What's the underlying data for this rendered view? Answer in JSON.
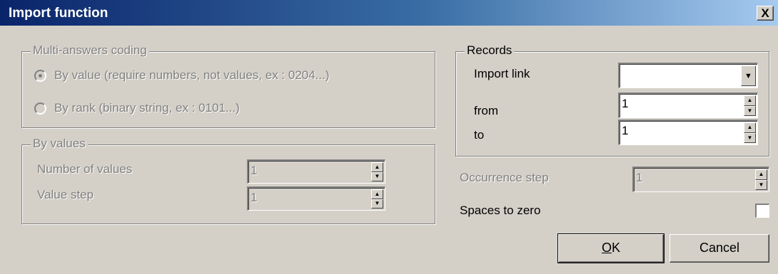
{
  "window": {
    "title": "Import function",
    "close_label": "X"
  },
  "multi_answers": {
    "legend": "Multi-answers coding",
    "options": [
      {
        "label": "By value (require numbers, not values, ex : 0204...)",
        "checked": true
      },
      {
        "label": "By rank (binary string, ex : 0101...)",
        "checked": false
      }
    ]
  },
  "by_values": {
    "legend": "By values",
    "number_of_values_label": "Number of values",
    "number_of_values": "1",
    "value_step_label": "Value step",
    "value_step": "1"
  },
  "records": {
    "legend": "Records",
    "import_link_label": "Import link",
    "import_link_value": "",
    "from_label": "from",
    "from_value": "1",
    "to_label": "to",
    "to_value": "1"
  },
  "occurrence_step_label": "Occurrence step",
  "occurrence_step": "1",
  "spaces_to_zero_label": "Spaces to zero",
  "spaces_to_zero_checked": false,
  "buttons": {
    "ok_label": "K",
    "ok_mnemonic": "O",
    "cancel_label": "Cancel"
  }
}
